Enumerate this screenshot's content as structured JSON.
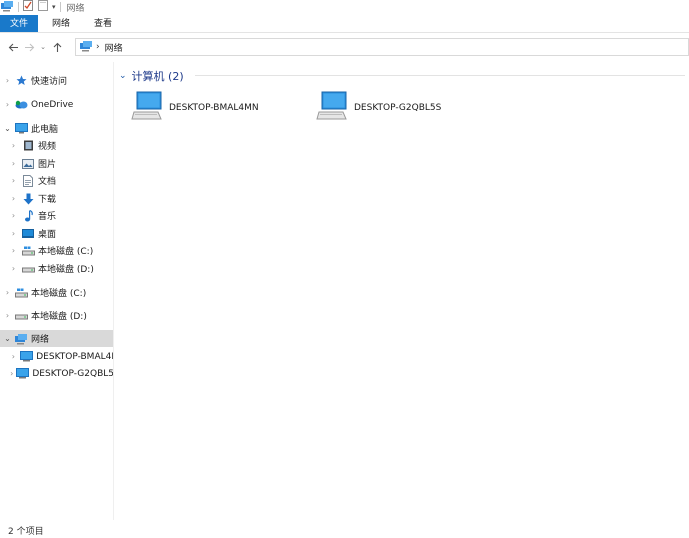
{
  "window": {
    "title": "网络"
  },
  "ribbon": {
    "tabs": [
      "文件",
      "网络",
      "查看"
    ]
  },
  "address": {
    "crumb": "网络"
  },
  "nav_tree": [
    {
      "label": "快速访问",
      "icon": "star-icon",
      "caret": "right"
    },
    {
      "label": "OneDrive",
      "icon": "onedrive-icon",
      "caret": "right"
    },
    {
      "label": "此电脑",
      "icon": "pc-icon",
      "caret": "down"
    },
    {
      "label": "视频",
      "icon": "video-icon",
      "caret": "right"
    },
    {
      "label": "图片",
      "icon": "pictures-icon",
      "caret": "right"
    },
    {
      "label": "文档",
      "icon": "documents-icon",
      "caret": "right"
    },
    {
      "label": "下载",
      "icon": "download-icon",
      "caret": "right"
    },
    {
      "label": "音乐",
      "icon": "music-icon",
      "caret": "right"
    },
    {
      "label": "桌面",
      "icon": "desktop-icon",
      "caret": "right"
    },
    {
      "label": "本地磁盘 (C:)",
      "icon": "drive-c-icon",
      "caret": "right"
    },
    {
      "label": "本地磁盘 (D:)",
      "icon": "drive-icon",
      "caret": "right"
    },
    {
      "label": "本地磁盘 (C:)",
      "icon": "drive-c-icon",
      "caret": "right"
    },
    {
      "label": "本地磁盘 (D:)",
      "icon": "drive-icon",
      "caret": "right"
    },
    {
      "label": "网络",
      "icon": "network-icon",
      "caret": "down"
    },
    {
      "label": "DESKTOP-BMAL4I",
      "icon": "computer-icon",
      "caret": "right"
    },
    {
      "label": "DESKTOP-G2QBL5",
      "icon": "computer-icon",
      "caret": "right"
    }
  ],
  "content": {
    "group_title": "计算机 (2)",
    "computers": [
      {
        "name": "DESKTOP-BMAL4MN"
      },
      {
        "name": "DESKTOP-G2QBL5S"
      }
    ]
  },
  "status": {
    "text": "2 个项目"
  },
  "colors": {
    "accent": "#1979ca",
    "selection": "#d9d9d9"
  }
}
